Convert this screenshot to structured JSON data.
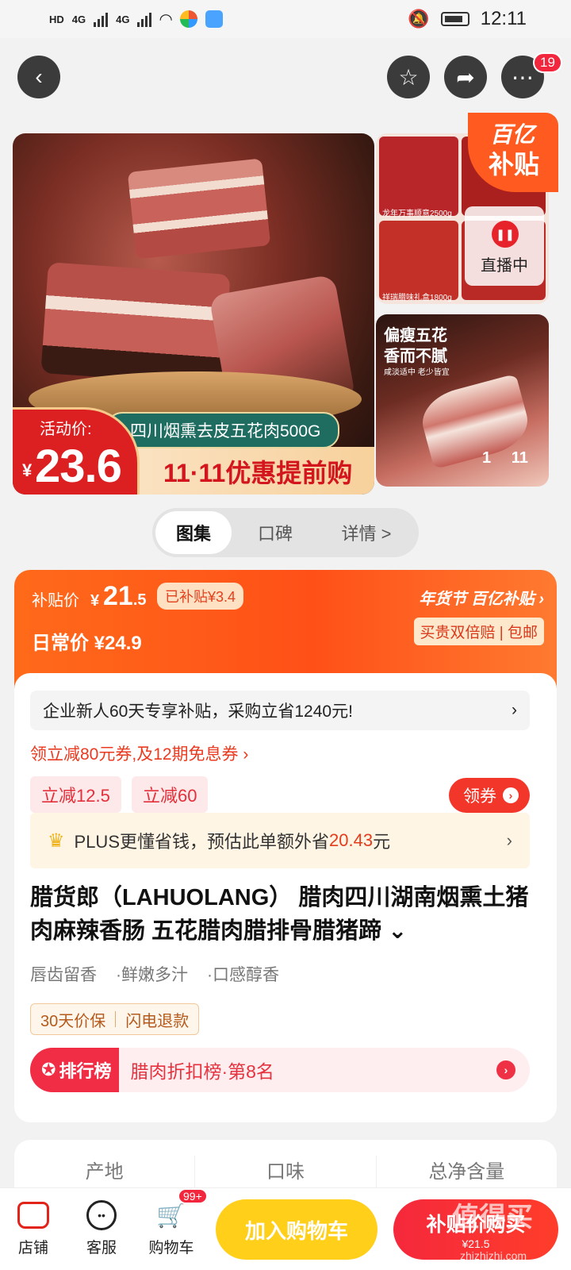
{
  "status_bar": {
    "time": "12:11",
    "net1": "HD",
    "net2": "HD",
    "sig1": "4G",
    "sig2": "4G"
  },
  "nav": {
    "more_badge": "19"
  },
  "gallery": {
    "main": {
      "product_name": "四川烟熏去皮五花肉500G",
      "event_text": "11·11优惠提前购",
      "activity_label": "活动价:",
      "activity_currency": "¥",
      "activity_price": "23.6"
    },
    "subsidy_badge": {
      "line1": "百亿",
      "line2": "补贴"
    },
    "live": {
      "label": "直播中"
    },
    "thumb1_captions": [
      "龙年万事顺意2500g",
      "祥瑞腊味礼盒1800g"
    ],
    "thumb2": {
      "headline": "偏瘦五花 香而不腻",
      "sub": "咸淡适中 老少皆宜"
    },
    "counter": {
      "current": "1",
      "total": "11"
    }
  },
  "tabs": [
    {
      "label": "图集"
    },
    {
      "label": "口碑"
    },
    {
      "label": "详情 >"
    }
  ],
  "price": {
    "subsidy_label": "补贴价",
    "currency": "¥",
    "subsidy_int": "21",
    "subsidy_dec": ".5",
    "subsidy_chip": "已补贴¥3.4",
    "daily_label": "日常价 ¥24.9",
    "brand_tag": "年货节 百亿补贴 ›",
    "promise": "买贵双倍赔 | 包邮"
  },
  "offers": {
    "new_user": "企业新人60天专享补贴，采购立省1240元!",
    "new_user_arrow": "›",
    "coupon_line": "领立减80元券,及12期免息券 ›",
    "discounts": [
      "立减12.5",
      "立减60"
    ],
    "get_coupon": "领券",
    "plus_prefix": "PLUS更懂省钱，预估此单额外省",
    "plus_amount": "20.43",
    "plus_suffix": "元",
    "plus_arrow": "›"
  },
  "product": {
    "title": "腊货郎（LAHUOLANG） 腊肉四川湖南烟熏土猪肉麻辣香肠 五花腊肉腊排骨腊猪蹄 ⌄",
    "features": [
      "唇齿留香",
      "·鲜嫩多汁",
      "·口感醇香"
    ],
    "guarantees": [
      "30天价保",
      "闪电退款"
    ],
    "rank_badge": "排行榜",
    "rank_text": "腊肉折扣榜·第8名"
  },
  "specs": [
    "产地",
    "口味",
    "总净含量"
  ],
  "bottom_bar": {
    "store": "店铺",
    "service": "客服",
    "cart": "购物车",
    "cart_badge": "99+",
    "add_to_cart": "加入购物车",
    "buy_now": "补贴价购买",
    "buy_now_price": "¥21.5"
  },
  "watermark": {
    "logo": "值得买",
    "url": "zhizhizhi.com"
  },
  "colors": {
    "accent": "#ff5a1f",
    "red": "#f2263c",
    "yellow": "#ffcf1a"
  }
}
